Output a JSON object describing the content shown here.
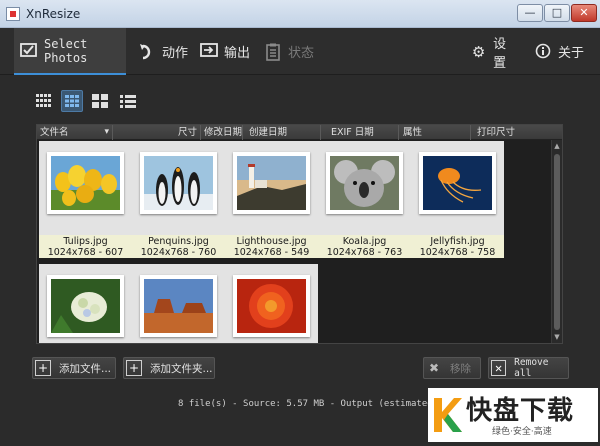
{
  "window": {
    "title": "XnResize",
    "min": "—",
    "max": "□",
    "close": "✕"
  },
  "toolbar": {
    "select_photos": "Select Photos",
    "action": "动作",
    "output": "输出",
    "status": "状态",
    "settings": "设置",
    "about": "关于"
  },
  "columns": {
    "name": "文件名",
    "size": "尺寸",
    "modified": "修改日期",
    "created": "创建日期",
    "exif": "EXIF 日期",
    "attributes": "属性",
    "print_size": "打印尺寸"
  },
  "files": [
    {
      "name": "Tulips.jpg",
      "info": "1024x768 - 607"
    },
    {
      "name": "Penquins.jpg",
      "info": "1024x768 - 760"
    },
    {
      "name": "Lighthouse.jpg",
      "info": "1024x768 - 549"
    },
    {
      "name": "Koala.jpg",
      "info": "1024x768 - 763"
    },
    {
      "name": "Jellyfish.jpg",
      "info": "1024x768 - 758"
    }
  ],
  "buttons": {
    "add_files": "添加文件...",
    "add_folder": "添加文件夹...",
    "remove": "移除",
    "remove_all": "Remove all"
  },
  "status_line": "8 file(s) - Source: 5.57 MB - Output (estimated): 0 B",
  "watermark": {
    "big": "快盘下载",
    "small": "绿色·安全·高速"
  }
}
